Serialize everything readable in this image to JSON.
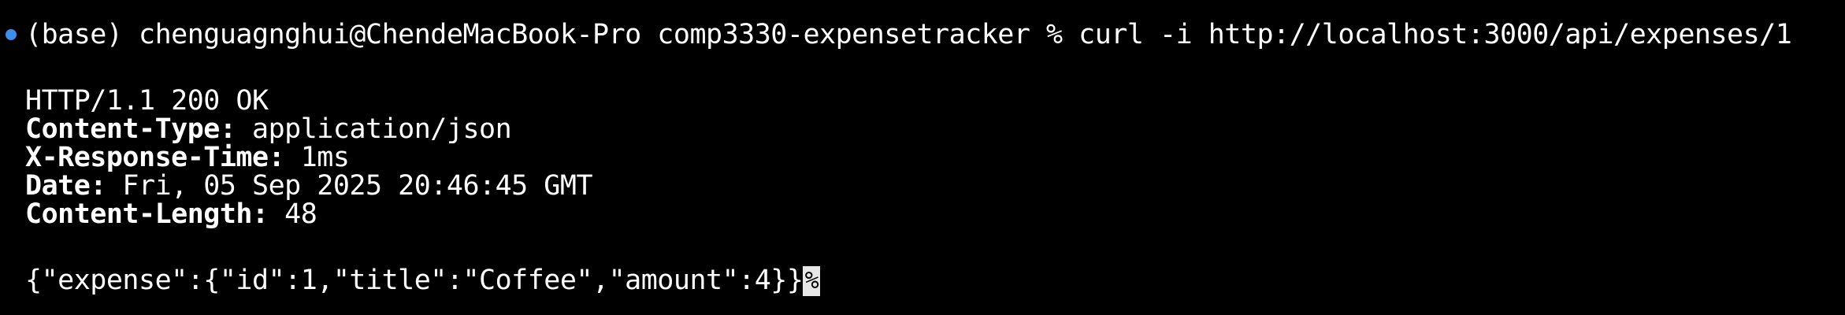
{
  "terminal": {
    "command_line": "(base) chenguagnghui@ChendeMacBook-Pro comp3330-expensetracker % curl -i http://localhost:3000/api/expenses/1",
    "status_line": "HTTP/1.1 200 OK",
    "headers": [
      {
        "key": "Content-Type:",
        "value": " application/json"
      },
      {
        "key": "X-Response-Time:",
        "value": " 1ms"
      },
      {
        "key": "Date:",
        "value": " Fri, 05 Sep 2025 20:46:45 GMT"
      },
      {
        "key": "Content-Length:",
        "value": " 48"
      }
    ],
    "body": "{\"expense\":{\"id\":1,\"title\":\"Coffee\",\"amount\":4}}",
    "end_marker": "%"
  },
  "colors": {
    "background": "#000000",
    "text": "#ffffff",
    "prompt_indicator": "#3b8eea",
    "cursor_block": "#e6e6e6"
  }
}
